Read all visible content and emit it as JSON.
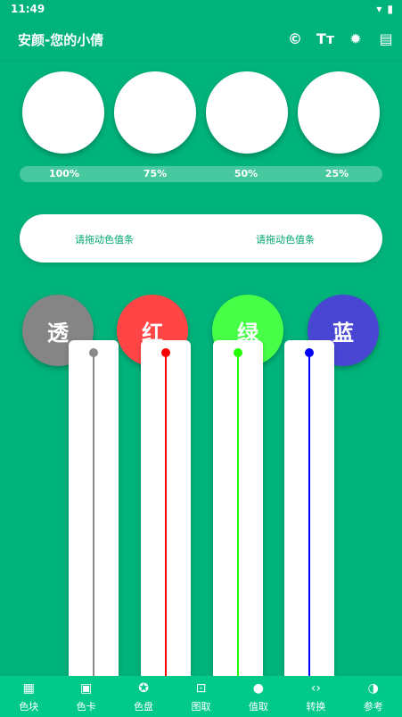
{
  "status": {
    "time": "11:49"
  },
  "appbar": {
    "title": "安颜-您的小倩",
    "actions": [
      {
        "icon": "copyright-icon",
        "glyph": "©"
      },
      {
        "icon": "text-size-icon",
        "glyph": "Tт"
      },
      {
        "icon": "brightness-icon",
        "glyph": "✹"
      },
      {
        "icon": "palette-bar-icon",
        "glyph": "▤"
      }
    ]
  },
  "opacity_levels": [
    "100%",
    "75%",
    "50%",
    "25%"
  ],
  "drag_hint": {
    "left": "请拖动色值条",
    "right": "请拖动色值条"
  },
  "channels": [
    {
      "label": "透",
      "color": "#858585",
      "line": "#8A8A8A"
    },
    {
      "label": "红",
      "color": "#FF4545",
      "line": "#FF0000"
    },
    {
      "label": "绿",
      "color": "#48FF48",
      "line": "#22FF00"
    },
    {
      "label": "蓝",
      "color": "#4A46D4",
      "line": "#0000FF"
    }
  ],
  "bottom_nav": [
    {
      "label": "色块",
      "icon": "grid-icon",
      "glyph": "▦"
    },
    {
      "label": "色卡",
      "icon": "card-icon",
      "glyph": "▣"
    },
    {
      "label": "色盘",
      "icon": "palette-icon",
      "glyph": "✪"
    },
    {
      "label": "图取",
      "icon": "image-pick-icon",
      "glyph": "⊡"
    },
    {
      "label": "值取",
      "icon": "dot-icon",
      "glyph": "●"
    },
    {
      "label": "转换",
      "icon": "code-icon",
      "glyph": "‹›"
    },
    {
      "label": "参考",
      "icon": "contrast-icon",
      "glyph": "◑"
    }
  ]
}
